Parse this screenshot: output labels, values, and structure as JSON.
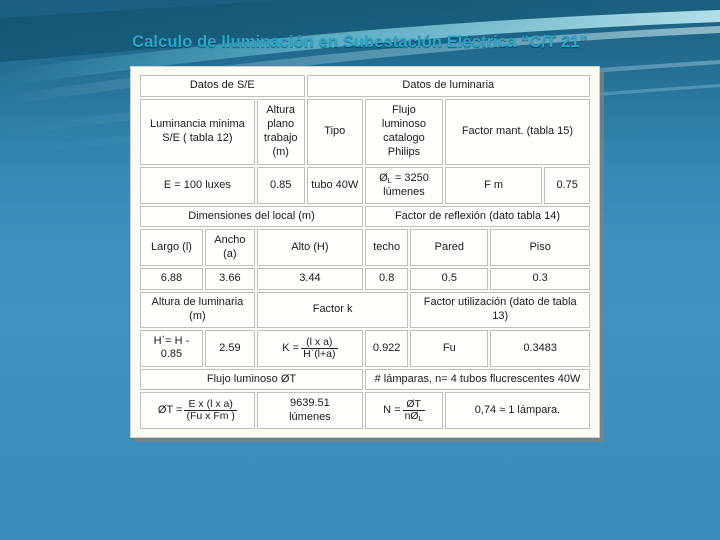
{
  "slide": {
    "title": "Calculo de Iluminación en Subestación Eléctrica “C/T 21”",
    "background_top_color": "#1b5d7e",
    "background_bottom_color": "#3a8cba",
    "title_color": "#25a8c9",
    "table_background_color": "#fdfcf4"
  },
  "table": {
    "row1_headers": {
      "datos_se": "Datos de S/E",
      "datos_luminaria": "Datos de luminaria"
    },
    "row2_headers": {
      "luminancia": "Luminancia minima S/E ( tabla 12)",
      "altura_plano": "Altura plano trabajo (m)",
      "tipo": "Tipo",
      "flujo_catalogo": "Flujo luminoso catalogo Philips",
      "factor_mant": "Factor mant. (tabla 15)"
    },
    "row3_values": {
      "luminancia": "E = 100 luxes",
      "altura_plano": "0.85",
      "tipo": "tubo 40W",
      "flujo_symbol": "Ø",
      "flujo_sub": "L",
      "flujo_value": "= 3250",
      "flujo_unit": "lúmenes",
      "fm_label": "F m",
      "fm_value": "0.75"
    },
    "row4_headers": {
      "dimensiones": "Dimensiones del local (m)",
      "reflexion": "Factor de reflexión (dato tabla 14)"
    },
    "row5_headers": {
      "largo": "Largo (l)",
      "ancho": "Ancho (a)",
      "alto": "Alto (H)",
      "techo": "techo",
      "pared": "Pared",
      "piso": "Piso"
    },
    "row6_values": {
      "largo": "6.88",
      "ancho": "3.66",
      "alto": "3.44",
      "techo": "0.8",
      "pared": "0.5",
      "piso": "0.3"
    },
    "row7_headers": {
      "altura_luminaria": "Altura de luminaria (m)",
      "factor_k": "Factor k",
      "factor_utilizacion": "Factor utilización (dato de tabla 13)"
    },
    "row8_values": {
      "altura_formula": "H`= H - 0.85",
      "altura_value": "2.59",
      "k_lead": "K =",
      "k_num": "(l x a)",
      "k_den": "H`(l+a)",
      "k_value": "0.922",
      "fu_label": "Fu",
      "fu_value": "0.3483"
    },
    "row9_headers": {
      "flujo_total": "Flujo luminoso ØT",
      "num_lamparas": "# lámparas, n= 4 tubos flucrescentes 40W"
    },
    "row10_values": {
      "phit_lead": "ØT =",
      "phit_num": "E x (l x a)",
      "phit_den": "(Fu x Fm )",
      "phit_value": "9639.51",
      "phit_unit": "lúmenes",
      "n_lead": "N =",
      "n_num": "ØT",
      "n_den_n": "n",
      "n_den_symbol": "Ø",
      "n_den_sub": "L",
      "n_result": "0,74 ≈ 1 lámpara."
    }
  }
}
